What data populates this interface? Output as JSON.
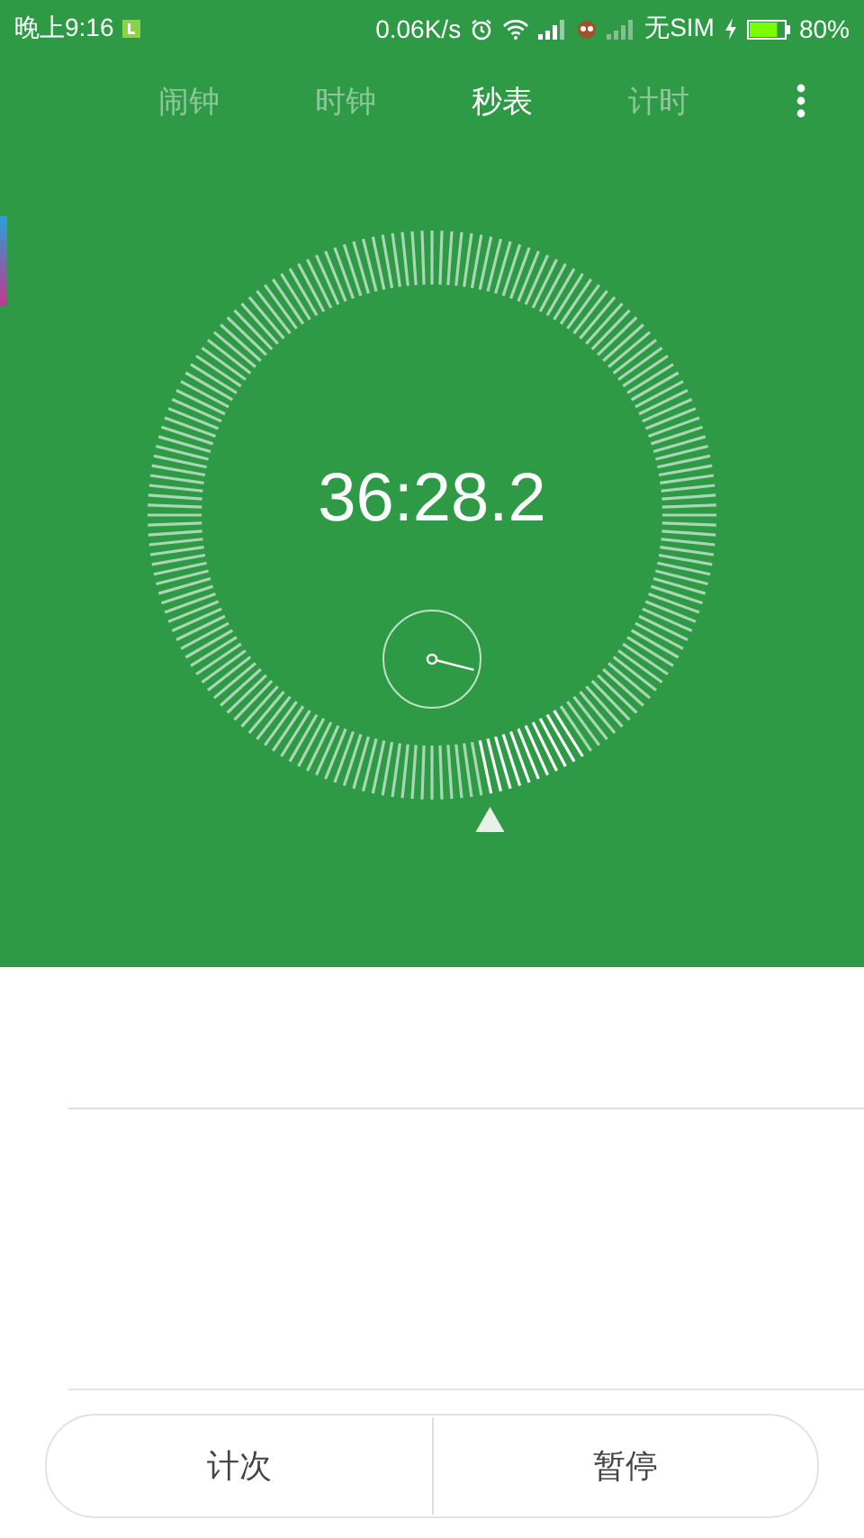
{
  "status_bar": {
    "time": "晚上9:16",
    "speed": "0.06K/s",
    "sim": "无SIM",
    "battery": "80%"
  },
  "tabs": [
    {
      "label": "闹钟",
      "selected": false
    },
    {
      "label": "时钟",
      "selected": false
    },
    {
      "label": "秒表",
      "selected": true
    },
    {
      "label": "计时",
      "selected": false
    }
  ],
  "stopwatch": {
    "time": "36:28.2"
  },
  "buttons": [
    {
      "label": "计次"
    },
    {
      "label": "暂停"
    }
  ]
}
